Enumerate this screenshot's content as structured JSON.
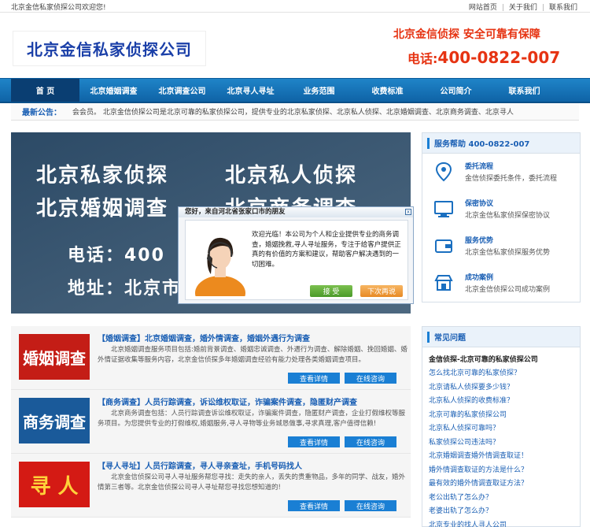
{
  "topbar": {
    "welcome": "北京金信私家侦探公司欢迎您!",
    "links": [
      "网站首页",
      "关于我们",
      "联系我们"
    ]
  },
  "header": {
    "logo": "北京金信私家侦探公司",
    "slogan": "北京金信侦探  安全可靠有保障",
    "phone_label": "电话:",
    "phone": "400-0822-007"
  },
  "nav": [
    "首 页",
    "北京婚姻调查",
    "北京调查公司",
    "北京寻人寻址",
    "业务范围",
    "收费标准",
    "公司简介",
    "联系我们"
  ],
  "notice": {
    "label": "最新公告：",
    "text": "会会员。  北京金信侦探公司是北京可靠的私家侦探公司，提供专业的北京私家侦探、北京私人侦探、北京婚姻调查、北京商务调查、北京寻人"
  },
  "banner": {
    "lines": [
      "北京私家侦探",
      "北京私人侦探",
      "北京婚姻调查",
      "北京商务调查",
      "电话：400",
      "地址：北京市"
    ]
  },
  "popup": {
    "title": "您好，来自河北省张家口市的朋友",
    "close": "x",
    "text": "欢迎光临！本公司为个人和企业提供专业的商务调查，婚姻挽救,寻人寻址服务，专注于给客户提供正真的有价值的方案和建议，帮助客户解决遇到的一切困难。",
    "accept": "接  受",
    "later": "下次再说"
  },
  "sidebar": {
    "service_title": "服务帮助  400-0822-007",
    "items": [
      {
        "title": "委托流程",
        "desc": "金信侦探委托条件，委托流程",
        "icon": "location-icon"
      },
      {
        "title": "保密协议",
        "desc": "北京金信私家侦探保密协议",
        "icon": "monitor-icon"
      },
      {
        "title": "服务优势",
        "desc": "北京金信私家侦探服务优势",
        "icon": "wallet-icon"
      },
      {
        "title": "成功案例",
        "desc": "北京金信侦探公司成功案例",
        "icon": "store-icon"
      }
    ],
    "faq_title": "常见问题",
    "faq_subtitle": "金信侦探-北京可靠的私家侦探公司",
    "faq": [
      "怎么找北京可靠的私家侦探？",
      "北京请私人侦探要多少钱？",
      "北京私人侦探的收费标准？",
      "北京可靠的私家侦探公司",
      "北京私人侦探可靠吗？",
      "私家侦探公司违法吗？",
      "北京婚姻调查婚外情调查取证！",
      "婚外情调查取证的方法是什么？",
      "最有效的婚外情调查取证方法？",
      "老公出轨了怎么办？",
      "老婆出轨了怎么办？",
      "北京专业的找人寻人公司"
    ]
  },
  "services": [
    {
      "image_text": "婚姻调查",
      "title": "【婚姻调查】北京婚姻调查，婚外情调查，婚姻外遇行为调查",
      "desc": "北京婚姻调查服务项目包括:婚前背景调查、婚姻忠诚调查、外遇行为调查、解除婚姻、挽回婚姻、婚外情证据收集等服务内容，北京金信侦探多年婚姻调查经验有能力处理各类婚姻调查项目。",
      "btn_detail": "查看详情",
      "btn_consult": "在线咨询"
    },
    {
      "image_text": "商务调查",
      "title": "【商务调查】人员行踪调查，诉讼维权取证，诈骗案件调查，隐匿财产调查",
      "desc": "北京商务调查包括：人员行踪调查诉讼维权取证，诈骗案件调查，隐匿财产调查，企业打假维权等服务项目。为您提供专业的打假维权,婚姻服务,寻人寻物等业务城恳做事,寻求真理,客户值得信赖!",
      "btn_detail": "查看详情",
      "btn_consult": "在线咨询"
    },
    {
      "image_text": "寻 人",
      "title": "【寻人寻址】人员行踪调查，寻人寻亲查址，手机号码找人",
      "desc": "北京金信侦探公司寻人寻址服务帮您寻找：走失的亲人，丢失的贵重物品，多年的同学、战友，婚外情第三者等。北京金信侦探公司寻人寻址帮您寻找您想知道的!",
      "btn_detail": "查看详情",
      "btn_consult": "在线咨询"
    }
  ]
}
